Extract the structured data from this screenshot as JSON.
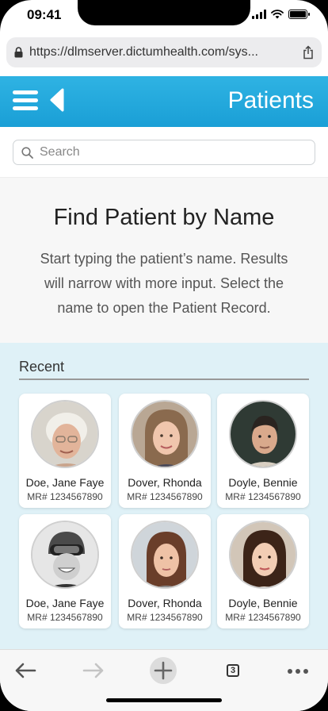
{
  "status": {
    "time": "09:41"
  },
  "browser": {
    "url": "https://dlmserver.dictumhealth.com/sys..."
  },
  "header": {
    "title": "Patients"
  },
  "search": {
    "placeholder": "Search",
    "value": ""
  },
  "intro": {
    "title": "Find Patient by Name",
    "description": "Start typing the patient’s name. Results will narrow with more input. Select the name to open the Patient Record."
  },
  "recent": {
    "label": "Recent",
    "patients": [
      {
        "name": "Doe, Jane Faye",
        "mr": "MR# 1234567890"
      },
      {
        "name": "Dover, Rhonda",
        "mr": "MR# 1234567890"
      },
      {
        "name": "Doyle, Bennie",
        "mr": "MR# 1234567890"
      },
      {
        "name": "Doe, Jane Faye",
        "mr": "MR# 1234567890"
      },
      {
        "name": "Dover, Rhonda",
        "mr": "MR# 1234567890"
      },
      {
        "name": "Doyle, Bennie",
        "mr": "MR# 1234567890"
      }
    ]
  },
  "toolbar": {
    "tab_count": "3"
  },
  "colors": {
    "header_start": "#2fb3e3",
    "header_end": "#1a9fd6",
    "recent_bg": "#dff1f7"
  },
  "icons": [
    "lock-icon",
    "share-icon",
    "menu-icon",
    "back-icon",
    "search-icon",
    "back-arrow-icon",
    "forward-arrow-icon",
    "new-tab-icon",
    "tabs-icon",
    "more-icon"
  ]
}
